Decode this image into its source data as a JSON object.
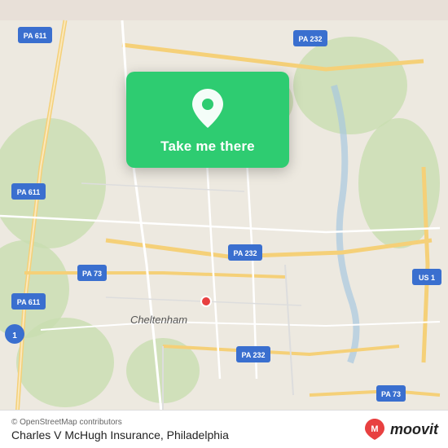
{
  "map": {
    "bg_color": "#e8e0d8"
  },
  "card": {
    "button_label": "Take me there",
    "icon": "location-pin-icon"
  },
  "bottom_bar": {
    "copyright": "© OpenStreetMap contributors",
    "location_name": "Charles V McHugh Insurance, Philadelphia",
    "moovit_label": "moovit"
  },
  "road_labels": [
    {
      "id": "pa611_top",
      "text": "PA 611"
    },
    {
      "id": "pa232_top_right",
      "text": "PA 232"
    },
    {
      "id": "pa232_mid",
      "text": "PA 232"
    },
    {
      "id": "pa611_mid_left",
      "text": "PA 611"
    },
    {
      "id": "pa73_left",
      "text": "PA 73"
    },
    {
      "id": "pa611_bottom_left",
      "text": "PA 611"
    },
    {
      "id": "pa232_bottom",
      "text": "PA 232"
    },
    {
      "id": "pa73_bottom_right",
      "text": "PA 73"
    },
    {
      "id": "us1_right",
      "text": "US 1"
    },
    {
      "id": "cheltenham_label",
      "text": "Cheltenham"
    }
  ]
}
